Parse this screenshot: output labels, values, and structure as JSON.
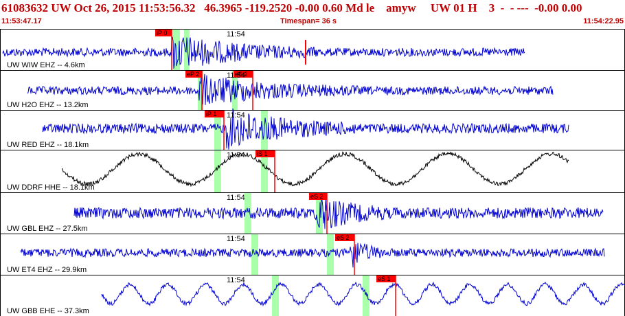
{
  "header": {
    "title": "61083632 UW Oct 26, 2015 11:53:56.32   46.3965 -119.2520 -0.00 0.60 Md le    amyw     UW 01 H    3  -  - ---  -0.00 0.00",
    "start_time": "11:53:47.17",
    "timespan": "Timespan=  36 s",
    "end_time": "11:54:22.95"
  },
  "colors": {
    "header_text": "#c00000",
    "trace_blue": "#0000d0",
    "trace_black": "#000000",
    "pick_red": "#ff0000",
    "window_green": "#aaffaa"
  },
  "panels": [
    {
      "label": "UW WIW EHZ -- 4.6km",
      "tick": "11:54",
      "picks": [
        "iP 0"
      ],
      "trace_color": "blue",
      "type": "eq"
    },
    {
      "label": "UW H2O EHZ -- 13.2km",
      "tick": "11:54",
      "picks": [
        "eP 2",
        "eS 2"
      ],
      "trace_color": "blue",
      "type": "noise"
    },
    {
      "label": "UW RED EHZ -- 18.1km",
      "tick": "11:54",
      "picks": [
        "iP 1"
      ],
      "trace_color": "blue",
      "type": "noise"
    },
    {
      "label": "UW DDRF HHE -- 18.1km",
      "tick": "11:54",
      "picks": [
        "iS 1"
      ],
      "trace_color": "black",
      "type": "wave"
    },
    {
      "label": "UW GBL EHZ -- 27.5km",
      "tick": "11:54",
      "picks": [
        "eS 2"
      ],
      "trace_color": "blue",
      "type": "noise"
    },
    {
      "label": "UW ET4 EHZ -- 29.9km",
      "tick": "11:54",
      "picks": [
        "eS 2"
      ],
      "trace_color": "blue",
      "type": "noise"
    },
    {
      "label": "UW GBB EHE -- 37.3km",
      "tick": "11:54",
      "picks": [
        "eS 1"
      ],
      "trace_color": "blue",
      "type": "wave"
    }
  ]
}
